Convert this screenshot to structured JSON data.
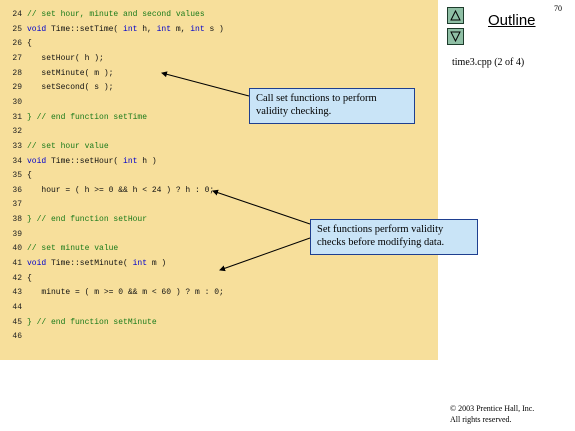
{
  "slide": {
    "page_number": "70"
  },
  "sidebar": {
    "outline_label": "Outline",
    "file_label": "time3.cpp (2 of 4)",
    "up_button_icon": "triangle-up-icon",
    "down_button_icon": "triangle-down-icon"
  },
  "code": {
    "lines": [
      {
        "n": "24",
        "t": "// set hour, minute and second values",
        "k": "comment"
      },
      {
        "n": "25",
        "t": "void Time::setTime( int h, int m, int s )",
        "k": "code"
      },
      {
        "n": "26",
        "t": "{",
        "k": "code"
      },
      {
        "n": "27",
        "t": "   setHour( h );",
        "k": "code"
      },
      {
        "n": "28",
        "t": "   setMinute( m );",
        "k": "code"
      },
      {
        "n": "29",
        "t": "   setSecond( s );",
        "k": "code"
      },
      {
        "n": "30",
        "t": "",
        "k": "code"
      },
      {
        "n": "31",
        "t": "} // end function setTime",
        "k": "comment"
      },
      {
        "n": "32",
        "t": "",
        "k": "code"
      },
      {
        "n": "33",
        "t": "// set hour value",
        "k": "comment"
      },
      {
        "n": "34",
        "t": "void Time::setHour( int h )",
        "k": "code"
      },
      {
        "n": "35",
        "t": "{",
        "k": "code"
      },
      {
        "n": "36",
        "t": "   hour = ( h >= 0 && h < 24 ) ? h : 0;",
        "k": "code"
      },
      {
        "n": "37",
        "t": "",
        "k": "code"
      },
      {
        "n": "38",
        "t": "} // end function setHour",
        "k": "comment"
      },
      {
        "n": "39",
        "t": "",
        "k": "code"
      },
      {
        "n": "40",
        "t": "// set minute value",
        "k": "comment"
      },
      {
        "n": "41",
        "t": "void Time::setMinute( int m )",
        "k": "code"
      },
      {
        "n": "42",
        "t": "{",
        "k": "code"
      },
      {
        "n": "43",
        "t": "   minute = ( m >= 0 && m < 60 ) ? m : 0;",
        "k": "code"
      },
      {
        "n": "44",
        "t": "",
        "k": "code"
      },
      {
        "n": "45",
        "t": "} // end function setMinute",
        "k": "comment"
      },
      {
        "n": "46",
        "t": "",
        "k": "code"
      }
    ]
  },
  "callouts": {
    "first": "Call set functions to perform validity checking.",
    "second": "Set functions perform validity checks before modifying data."
  },
  "footer": {
    "copyright_line1": "© 2003 Prentice Hall, Inc.",
    "copyright_line2": "All rights reserved."
  },
  "colors": {
    "code_background": "#f7df9b",
    "callout_background": "#c9e4f7",
    "nav_button": "#8fbfa5"
  }
}
